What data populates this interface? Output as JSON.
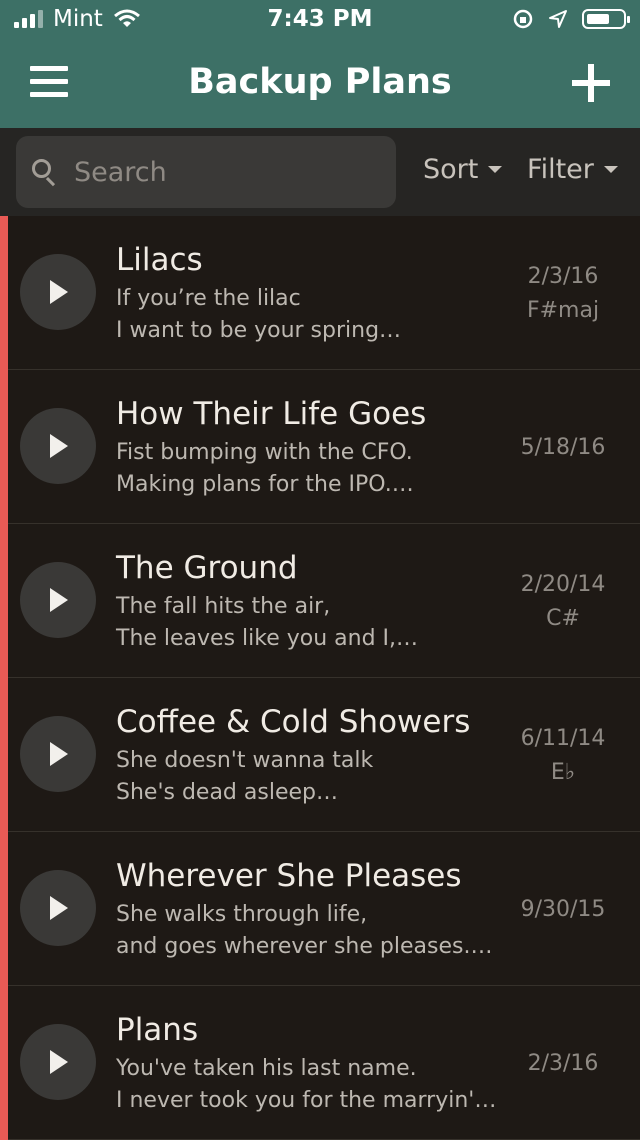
{
  "status": {
    "carrier": "Mint",
    "time": "7:43 PM"
  },
  "nav": {
    "title": "Backup Plans"
  },
  "toolbar": {
    "search_placeholder": "Search",
    "sort_label": "Sort",
    "filter_label": "Filter"
  },
  "colors": {
    "header": "#3d7066",
    "accent_bar": "#e85a55",
    "background": "#1e1915"
  },
  "songs": [
    {
      "title": "Lilacs",
      "line1": "If you’re the lilac",
      "line2": "I want to be your spring…",
      "date": "2/3/16",
      "key": "F#maj"
    },
    {
      "title": "How Their Life Goes",
      "line1": "Fist bumping with the CFO.",
      "line2": "Making plans for the IPO.…",
      "date": "5/18/16",
      "key": ""
    },
    {
      "title": "The Ground",
      "line1": "The fall hits the air,",
      "line2": "The leaves like you and I,…",
      "date": "2/20/14",
      "key": "C#"
    },
    {
      "title": "Coffee & Cold Showers",
      "line1": "She doesn't wanna talk",
      "line2": "She's dead asleep…",
      "date": "6/11/14",
      "key": "E♭"
    },
    {
      "title": "Wherever She Pleases",
      "line1": "She walks through life,",
      "line2": "and goes wherever she pleases.…",
      "date": "9/30/15",
      "key": ""
    },
    {
      "title": "Plans",
      "line1": "You've taken his last name.",
      "line2": "I never took you for the marryin'…",
      "date": "2/3/16",
      "key": ""
    }
  ]
}
